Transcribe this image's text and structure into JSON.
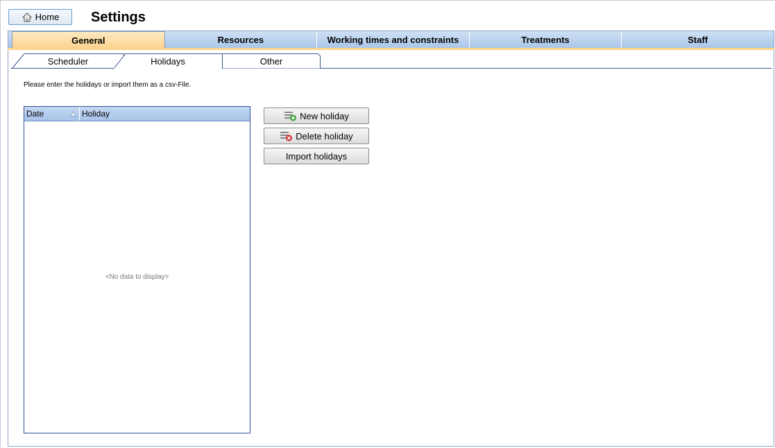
{
  "header": {
    "home_label": "Home",
    "title": "Settings"
  },
  "main_tabs": [
    {
      "label": "General",
      "active": true
    },
    {
      "label": "Resources",
      "active": false
    },
    {
      "label": "Working times and constraints",
      "active": false
    },
    {
      "label": "Treatments",
      "active": false
    },
    {
      "label": "Staff",
      "active": false
    }
  ],
  "sub_tabs": [
    {
      "label": "Scheduler",
      "active": false
    },
    {
      "label": "Holidays",
      "active": true
    },
    {
      "label": "Other",
      "active": false
    }
  ],
  "holidays": {
    "instructions": "Please enter the holidays or import them as a csv-File.",
    "grid": {
      "columns": [
        "Date",
        "Holiday"
      ],
      "sort_column": "Date",
      "empty_text": "<No data to display>",
      "rows": []
    },
    "buttons": {
      "new": "New holiday",
      "delete": "Delete holiday",
      "import": "Import holidays"
    }
  },
  "colors": {
    "active_tab": "#fbd38a",
    "tab_strip": "#a9c7ea",
    "grid_border": "#2d4f8e"
  }
}
